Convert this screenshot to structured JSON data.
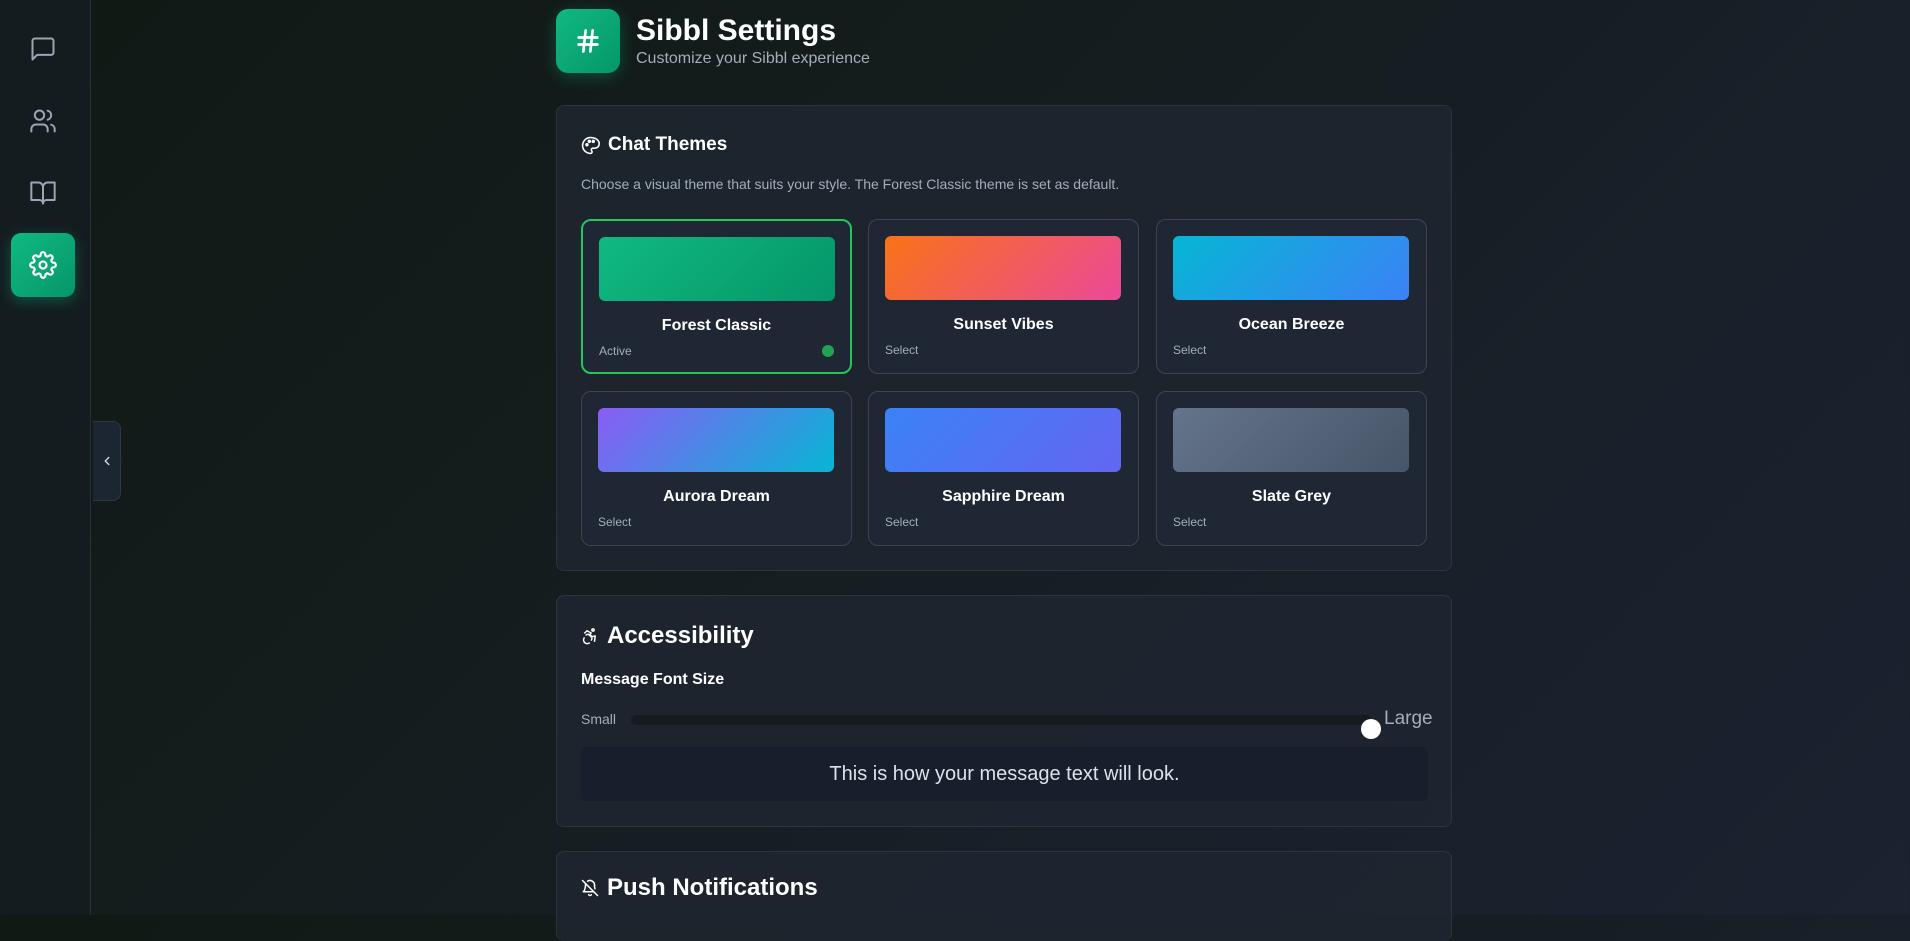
{
  "sidebar": {
    "items": [
      {
        "icon": "chat-icon",
        "active": false
      },
      {
        "icon": "users-icon",
        "active": false
      },
      {
        "icon": "book-icon",
        "active": false
      },
      {
        "icon": "gear-icon",
        "active": true
      }
    ]
  },
  "header": {
    "logo_icon": "hash-icon",
    "title": "Sibbl Settings",
    "subtitle": "Customize your Sibbl experience"
  },
  "chat_themes": {
    "title": "Chat Themes",
    "icon": "palette-icon",
    "description": "Choose a visual theme that suits your style. The Forest Classic theme is set as default.",
    "themes": [
      {
        "name": "Forest Classic",
        "status": "Active",
        "active": true,
        "colors": [
          "#10b981",
          "#059669"
        ]
      },
      {
        "name": "Sunset Vibes",
        "status": "Select",
        "active": false,
        "colors": [
          "#f97316",
          "#ec4899"
        ]
      },
      {
        "name": "Ocean Breeze",
        "status": "Select",
        "active": false,
        "colors": [
          "#06b6d4",
          "#3b82f6"
        ]
      },
      {
        "name": "Aurora Dream",
        "status": "Select",
        "active": false,
        "colors": [
          "#8b5cf6",
          "#06b6d4"
        ]
      },
      {
        "name": "Sapphire Dream",
        "status": "Select",
        "active": false,
        "colors": [
          "#3b82f6",
          "#6366f1"
        ]
      },
      {
        "name": "Slate Grey",
        "status": "Select",
        "active": false,
        "colors": [
          "#64748b",
          "#475569"
        ]
      }
    ]
  },
  "accessibility": {
    "title": "Accessibility",
    "icon": "accessibility-icon",
    "font_size_label": "Message Font Size",
    "slider_min_label": "Small",
    "slider_max_label": "Large",
    "slider_value": 1.0,
    "preview_text": "This is how your message text will look."
  },
  "push_notifications": {
    "title": "Push Notifications",
    "icon": "bell-off-icon"
  },
  "colors": {
    "accent": "#10b981",
    "active_border": "#22c55e"
  }
}
